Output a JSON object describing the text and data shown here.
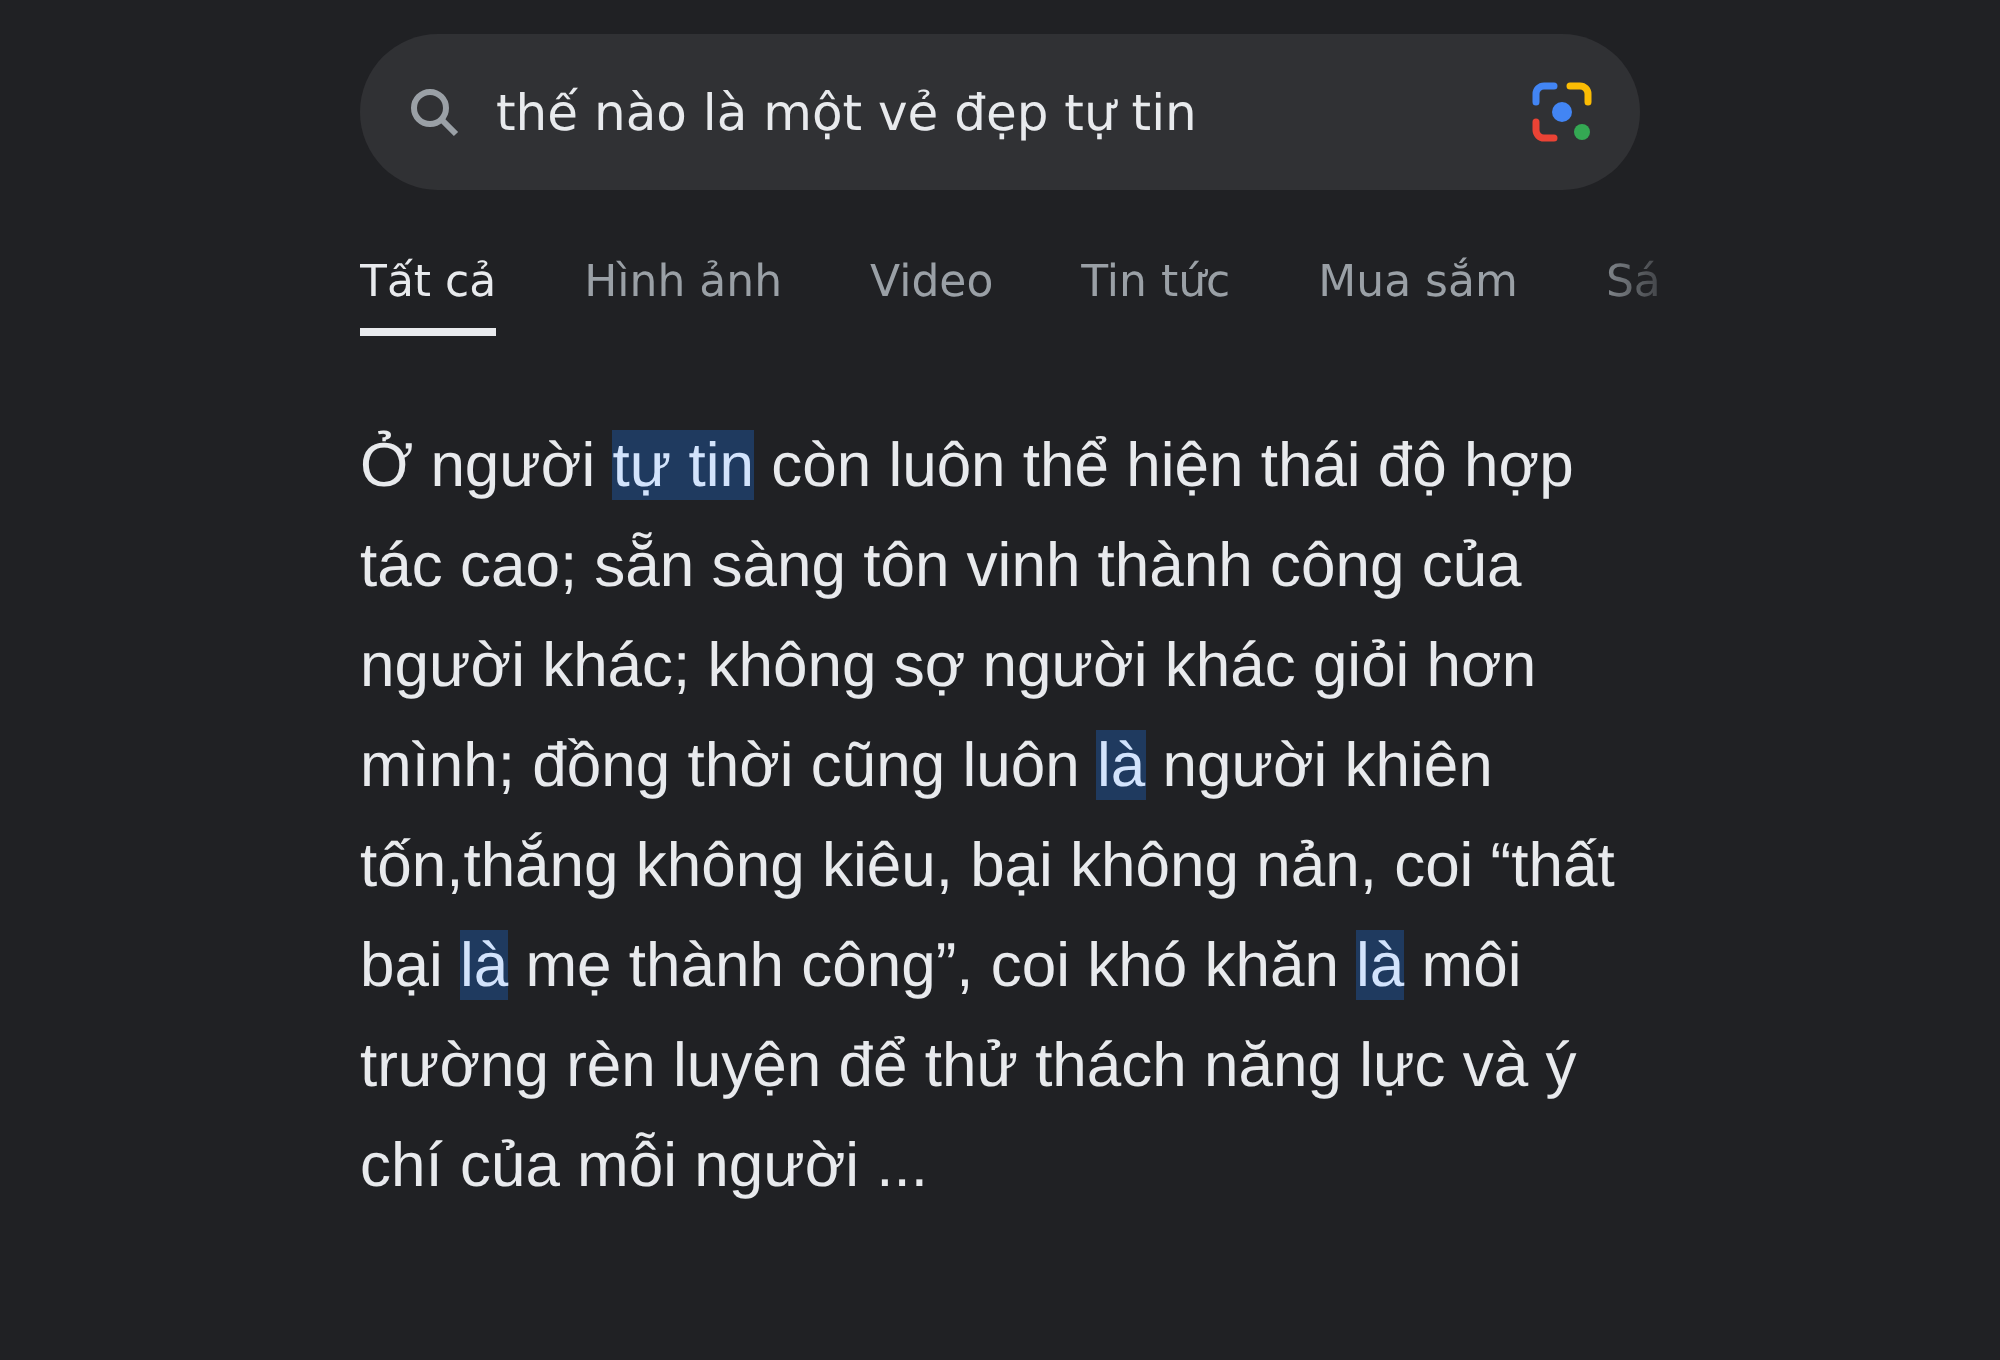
{
  "search": {
    "value": "thế nào là một vẻ đẹp tự tin"
  },
  "tabs": [
    {
      "label": "Tất cả",
      "selected": true
    },
    {
      "label": "Hình ảnh",
      "selected": false
    },
    {
      "label": "Video",
      "selected": false
    },
    {
      "label": "Tin tức",
      "selected": false
    },
    {
      "label": "Mua sắm",
      "selected": false
    },
    {
      "label": "Sá",
      "selected": false
    }
  ],
  "snippet": [
    {
      "text": "Ở người ",
      "highlighted": false
    },
    {
      "text": "tự tin",
      "highlighted": true
    },
    {
      "text": " còn luôn thể hiện thái độ hợp tác cao; sẵn sàng tôn vinh thành công của người khác; không sợ người khác giỏi hơn mình; đồng thời cũng luôn ",
      "highlighted": false
    },
    {
      "text": "là",
      "highlighted": true
    },
    {
      "text": " người khiên tốn,thắng không kiêu, bại không nản, coi “thất bại ",
      "highlighted": false
    },
    {
      "text": "là",
      "highlighted": true
    },
    {
      "text": " mẹ thành công”, coi khó khăn ",
      "highlighted": false
    },
    {
      "text": "là",
      "highlighted": true
    },
    {
      "text": " môi trường rèn luyện để thử thách năng lực và ý chí của mỗi người ...",
      "highlighted": false
    }
  ]
}
